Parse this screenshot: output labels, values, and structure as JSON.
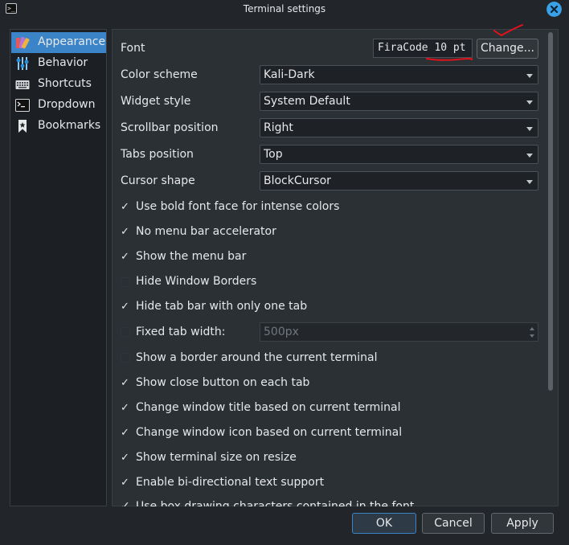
{
  "window": {
    "title": "Terminal settings"
  },
  "colors": {
    "accent": "#3c84c8",
    "close": "#3aa0e8",
    "annotation": "#e0121b"
  },
  "sidebar": {
    "items": [
      {
        "label": "Appearance",
        "icon": "appearance-icon",
        "active": true
      },
      {
        "label": "Behavior",
        "icon": "behavior-icon"
      },
      {
        "label": "Shortcuts",
        "icon": "keyboard-icon"
      },
      {
        "label": "Dropdown",
        "icon": "terminal-icon"
      },
      {
        "label": "Bookmarks",
        "icon": "bookmark-icon"
      }
    ]
  },
  "font": {
    "label": "Font",
    "preview_prefix": "FiraCode ",
    "preview_size": "10 pt",
    "change_label": "Change..."
  },
  "settings": {
    "color_scheme": {
      "label": "Color scheme",
      "value": "Kali-Dark"
    },
    "widget_style": {
      "label": "Widget style",
      "value": "System Default"
    },
    "scrollbar_position": {
      "label": "Scrollbar position",
      "value": "Right"
    },
    "tabs_position": {
      "label": "Tabs position",
      "value": "Top"
    },
    "cursor_shape": {
      "label": "Cursor shape",
      "value": "BlockCursor"
    }
  },
  "checkboxes": [
    {
      "label": "Use bold font face for intense colors",
      "checked": true
    },
    {
      "label": "No menu bar accelerator",
      "checked": true
    },
    {
      "label": "Show the menu bar",
      "checked": true
    },
    {
      "label": "Hide Window Borders",
      "checked": false
    },
    {
      "label": "Hide tab bar with only one tab",
      "checked": true
    },
    {
      "label": "Fixed tab width:",
      "checked": false
    },
    {
      "label": "Show a border around the current terminal",
      "checked": false
    },
    {
      "label": "Show close button on each tab",
      "checked": true
    },
    {
      "label": "Change window title based on current terminal",
      "checked": true
    },
    {
      "label": "Change window icon based on current terminal",
      "checked": true
    },
    {
      "label": "Show terminal size on resize",
      "checked": true
    },
    {
      "label": "Enable bi-directional text support",
      "checked": true
    },
    {
      "label": "Use box drawing characters contained in the font",
      "checked": true
    }
  ],
  "fixed_tab_width": {
    "value": "500px"
  },
  "buttons": {
    "ok": "OK",
    "cancel": "Cancel",
    "apply": "Apply"
  },
  "check_glyph": "✓"
}
